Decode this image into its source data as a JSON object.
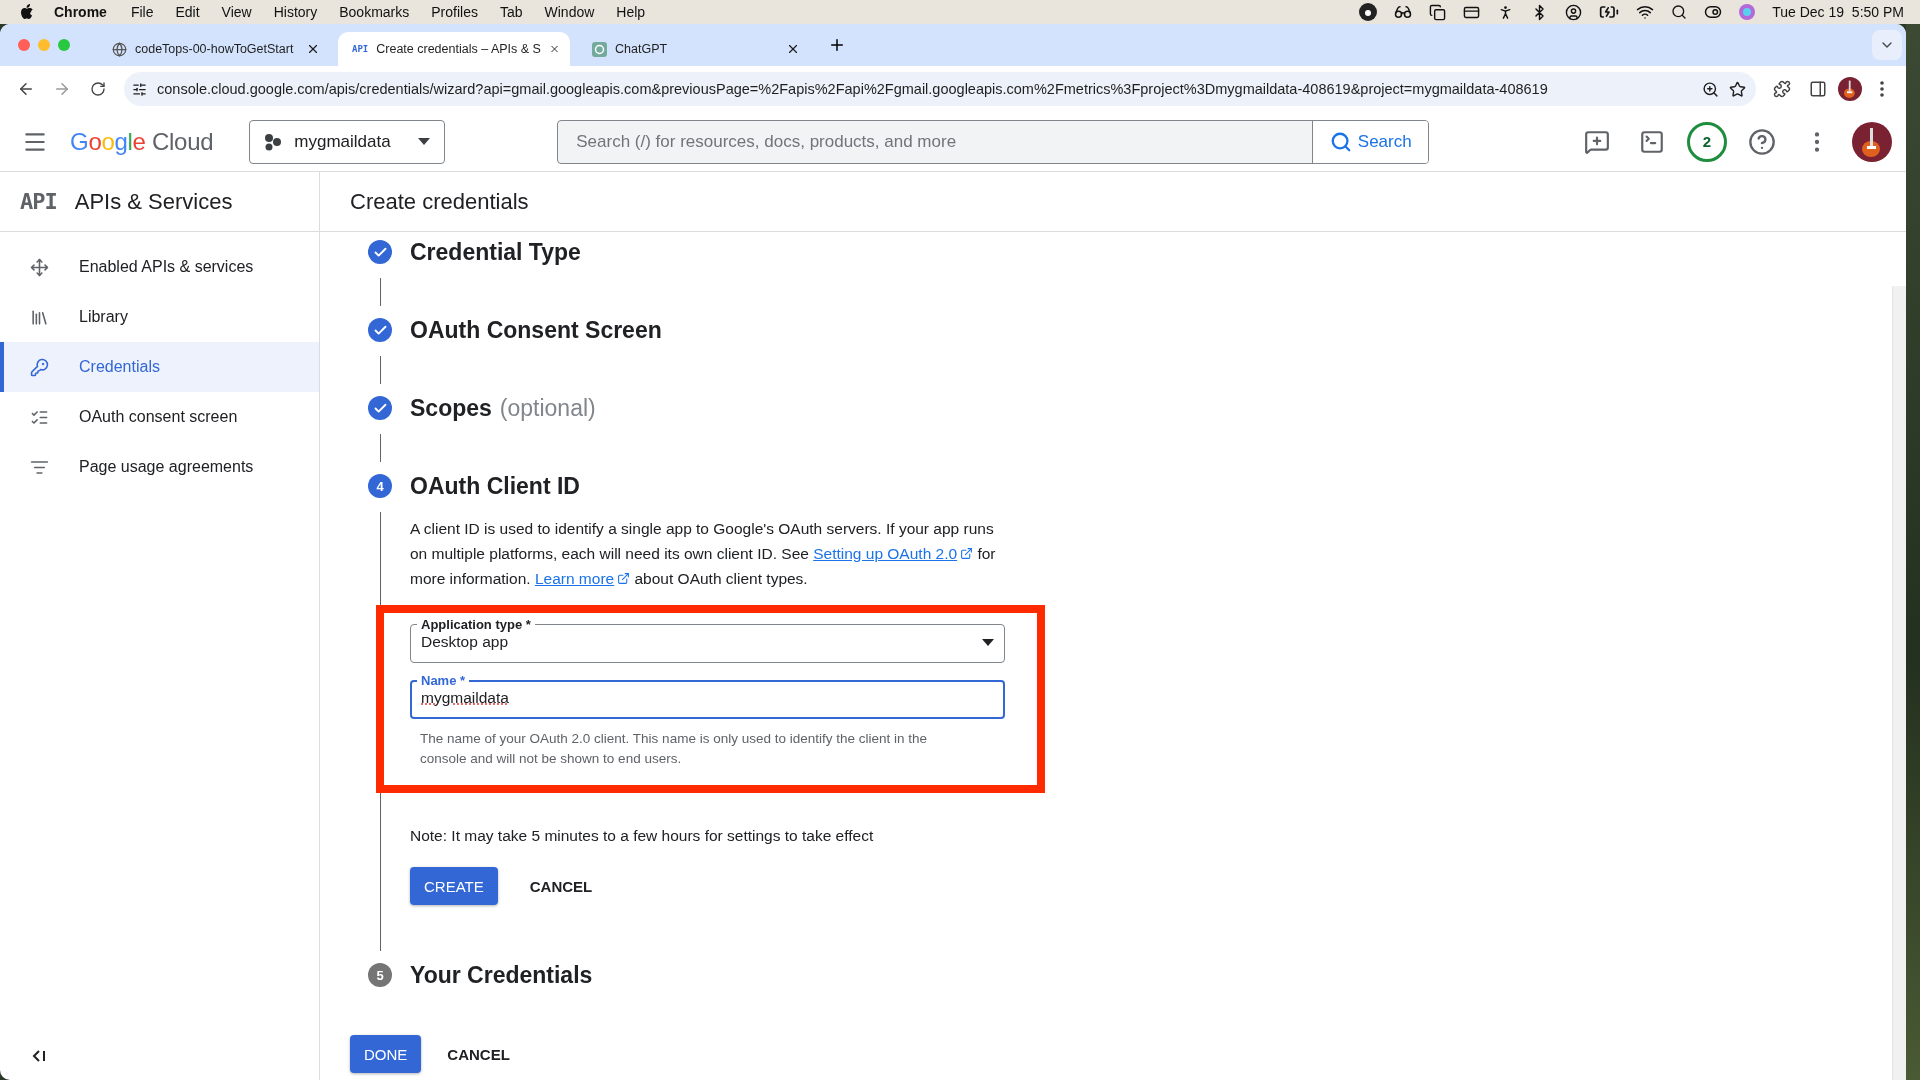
{
  "menu_bar": {
    "app": "Chrome",
    "items": [
      "File",
      "Edit",
      "View",
      "History",
      "Bookmarks",
      "Profiles",
      "Tab",
      "Window",
      "Help"
    ],
    "clock": "Tue Dec 19  5:50 PM"
  },
  "tabs": [
    {
      "title": "codeTops-00-howToGetStart",
      "selected": false
    },
    {
      "favicon_text": "API",
      "title": "Create credentials – APIs & S",
      "selected": true
    },
    {
      "title": "ChatGPT",
      "selected": false
    }
  ],
  "url": "console.cloud.google.com/apis/credentials/wizard?api=gmail.googleapis.com&previousPage=%2Fapis%2Fapi%2Fgmail.googleapis.com%2Fmetrics%3Fproject%3Dmygmaildata-408619&project=mygmaildata-408619",
  "header": {
    "logo": {
      "brand": "Google",
      "product": "Cloud"
    },
    "project": "mygmaildata",
    "search": {
      "placeholder": "Search (/) for resources, docs, products, and more",
      "button": "Search"
    },
    "notifications": "2"
  },
  "sidebar": {
    "badge": "API",
    "title": "APIs & Services",
    "items": [
      {
        "kind": "apis",
        "label": "Enabled APIs & services",
        "selected": false
      },
      {
        "kind": "library",
        "label": "Library",
        "selected": false
      },
      {
        "kind": "credentials",
        "label": "Credentials",
        "selected": true
      },
      {
        "kind": "consent",
        "label": "OAuth consent screen",
        "selected": false
      },
      {
        "kind": "agreements",
        "label": "Page usage agreements",
        "selected": false
      }
    ]
  },
  "page": {
    "title": "Create credentials",
    "steps": [
      {
        "kind": "done",
        "title": "Credential Type"
      },
      {
        "kind": "done",
        "title": "OAuth Consent Screen"
      },
      {
        "kind": "done",
        "title": "Scopes",
        "note": "(optional)"
      },
      {
        "kind": "current",
        "number": "4",
        "title": "OAuth Client ID"
      },
      {
        "kind": "pending",
        "number": "5",
        "title": "Your Credentials"
      }
    ],
    "form": {
      "description": [
        {
          "text": "A client ID is used to identify a single app to Google's OAuth servers. If your app runs on multiple platforms, each will need its own client ID. See "
        },
        {
          "link": "Setting up OAuth 2.0"
        },
        {
          "text": " for more information. "
        },
        {
          "link": "Learn more"
        },
        {
          "text": " about OAuth client types."
        }
      ],
      "fields": [
        {
          "kind": "select",
          "label": "Application type *",
          "value": "Desktop app",
          "focused": false
        },
        {
          "kind": "input",
          "label": "Name *",
          "value": "mygmaildata",
          "focused": true,
          "helper": "The name of your OAuth 2.0 client. This name is only used to identify the client in the console and will not be shown to end users."
        }
      ],
      "note": "Note: It may take 5 minutes to a few hours for settings to take effect",
      "create": "CREATE",
      "cancel": "CANCEL"
    },
    "footer": {
      "done": "DONE",
      "cancel": "CANCEL"
    }
  }
}
